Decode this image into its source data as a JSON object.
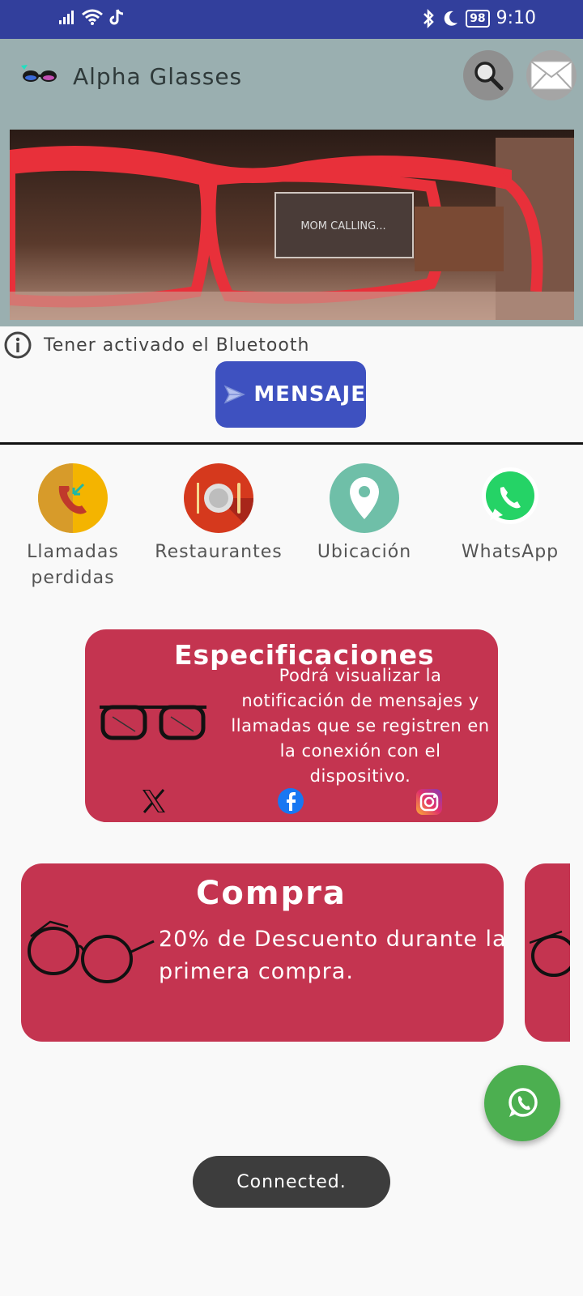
{
  "status_bar": {
    "time": "9:10",
    "battery": "98",
    "icons": [
      "signal-icon",
      "wifi-icon",
      "tiktok-icon",
      "bluetooth-icon",
      "moon-icon"
    ]
  },
  "app_bar": {
    "title": "Alpha Glasses",
    "logo_icon": "sunglasses-logo-icon",
    "search_icon": "search-icon",
    "mail_icon": "mail-icon"
  },
  "hero": {
    "overlay_text": "MOM CALLING..."
  },
  "info": {
    "icon": "info-icon",
    "text": "Tener activado el Bluetooth"
  },
  "message_button": {
    "label": "MENSAJE",
    "icon": "send-icon",
    "color": "#3e51c0"
  },
  "quick_actions": [
    {
      "label": "Llamadas perdidas",
      "icon": "missed-call-icon",
      "color": "#f4b400"
    },
    {
      "label": "Restaurantes",
      "icon": "restaurant-icon",
      "color": "#d5391d"
    },
    {
      "label": "Ubicación",
      "icon": "location-pin-icon",
      "color": "#6fbfa8"
    },
    {
      "label": "WhatsApp",
      "icon": "whatsapp-icon",
      "color": "#25d366"
    }
  ],
  "spec_card": {
    "title": "Especificaciones",
    "text": "Podrá visualizar la notificación de mensajes y llamadas que se registren en la conexión con el dispositivo.",
    "social_icons": [
      "x-icon",
      "facebook-icon",
      "instagram-icon"
    ],
    "color": "#c43450"
  },
  "purchase_card": {
    "title": "Compra",
    "text": "20% de Descuento durante la primera compra."
  },
  "toast": {
    "text": "Connected."
  },
  "fab": {
    "icon": "whatsapp-icon",
    "color": "#4caf50"
  }
}
